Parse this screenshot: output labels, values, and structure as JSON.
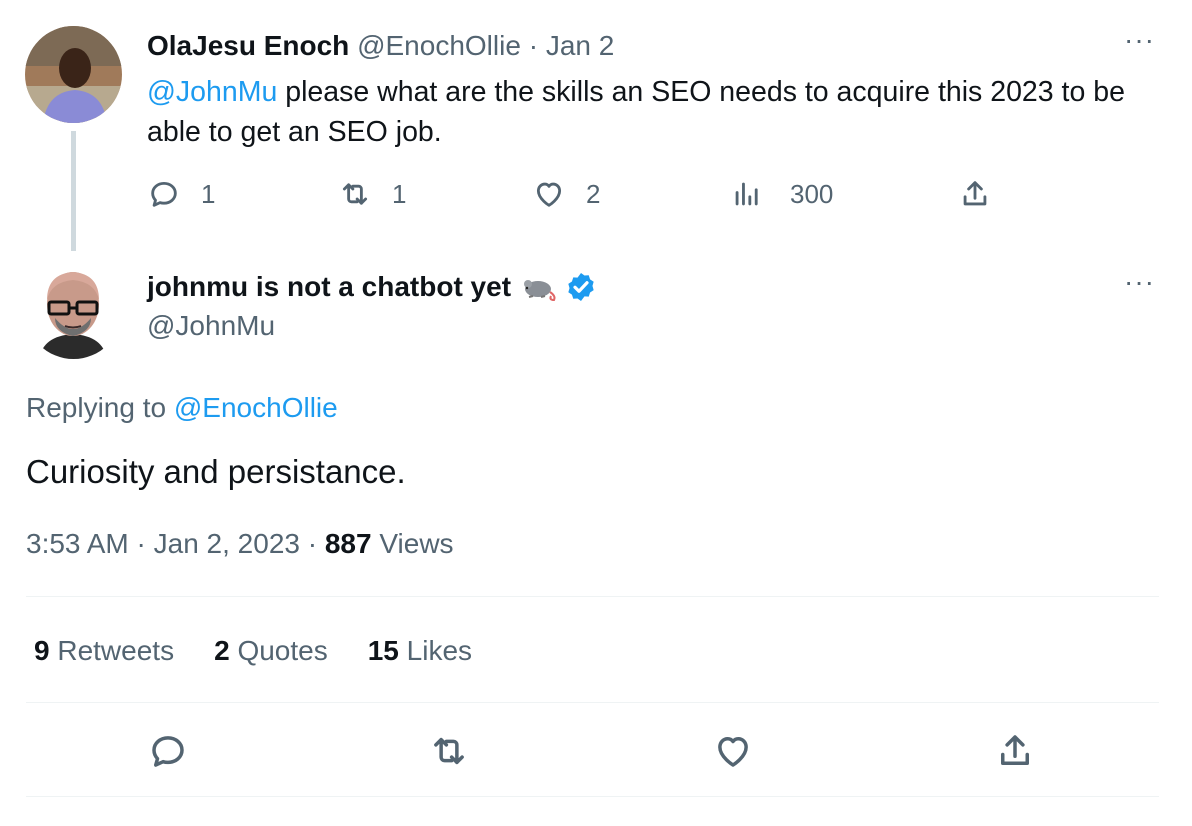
{
  "parent_tweet": {
    "author_name": "OlaJesu Enoch",
    "author_handle": "@EnochOllie",
    "separator": "·",
    "date": "Jan 2",
    "mention": "@JohnMu",
    "text": " please what are the skills an SEO needs to acquire this 2023 to be able to get an SEO job.",
    "reply_count": "1",
    "retweet_count": "1",
    "like_count": "2",
    "view_count": "300"
  },
  "main_tweet": {
    "author_name": "johnmu is not a chatbot yet",
    "author_handle": "@JohnMu",
    "replying_label": "Replying to",
    "replying_to": "@EnochOllie",
    "text": "Curiosity and persistance.",
    "time": "3:53 AM",
    "date": "Jan 2, 2023",
    "separator": "·",
    "views_count": "887",
    "views_label": "Views",
    "retweets_count": "9",
    "retweets_label": "Retweets",
    "quotes_count": "2",
    "quotes_label": "Quotes",
    "likes_count": "15",
    "likes_label": "Likes"
  },
  "more_label": "···",
  "colors": {
    "accent": "#1d9bf0",
    "text": "#0f1419",
    "secondary": "#536471",
    "divider": "#eff3f4"
  },
  "icons": [
    "reply-icon",
    "retweet-icon",
    "like-icon",
    "views-icon",
    "share-icon",
    "verified-badge-icon",
    "rat-emoji-icon",
    "more-icon"
  ]
}
